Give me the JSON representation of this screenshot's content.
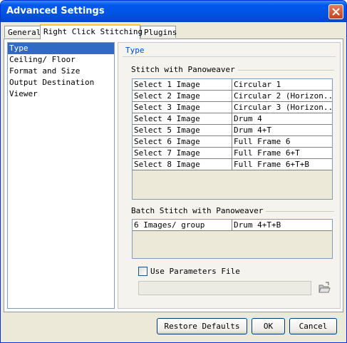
{
  "window": {
    "title": "Advanced Settings"
  },
  "tabs": [
    {
      "label": "General",
      "active": false
    },
    {
      "label": "Right Click Stitching",
      "active": true
    },
    {
      "label": "Plugins",
      "active": false
    }
  ],
  "sidebar": {
    "items": [
      {
        "label": "Type",
        "selected": true
      },
      {
        "label": "Ceiling/ Floor",
        "selected": false
      },
      {
        "label": "Format and Size",
        "selected": false
      },
      {
        "label": "Output Destination",
        "selected": false
      },
      {
        "label": "Viewer",
        "selected": false
      }
    ]
  },
  "content": {
    "header": "Type",
    "stitch_group": {
      "label": "Stitch with Panoweaver",
      "rows": [
        {
          "name": "Select 1 Image",
          "value": "Circular 1"
        },
        {
          "name": "Select 2 Image",
          "value": "Circular 2 (Horizon..."
        },
        {
          "name": "Select 3 Image",
          "value": "Circular 3 (Horizon..."
        },
        {
          "name": "Select 4 Image",
          "value": "Drum 4"
        },
        {
          "name": "Select 5 Image",
          "value": "Drum 4+T"
        },
        {
          "name": "Select 6 Image",
          "value": "Full Frame 6"
        },
        {
          "name": "Select 7 Image",
          "value": "Full Frame 6+T"
        },
        {
          "name": "Select 8 Image",
          "value": "Full Frame 6+T+B"
        }
      ]
    },
    "batch_group": {
      "label": "Batch Stitch with Panoweaver",
      "rows": [
        {
          "name": "6 Images/ group",
          "value": "Drum 4+T+B"
        }
      ]
    },
    "use_params": {
      "label": "Use Parameters File",
      "checked": false
    },
    "params_path": {
      "value": ""
    }
  },
  "footer": {
    "restore_label": "Restore Defaults",
    "ok_label": "OK",
    "cancel_label": "Cancel"
  },
  "colors": {
    "title_bar": "#0054e3",
    "selection": "#316ac5",
    "accent_header": "#0046d5",
    "tab_highlight": "#ffc73c"
  },
  "icons": {
    "close": "close-icon",
    "folder": "folder-open-icon"
  }
}
